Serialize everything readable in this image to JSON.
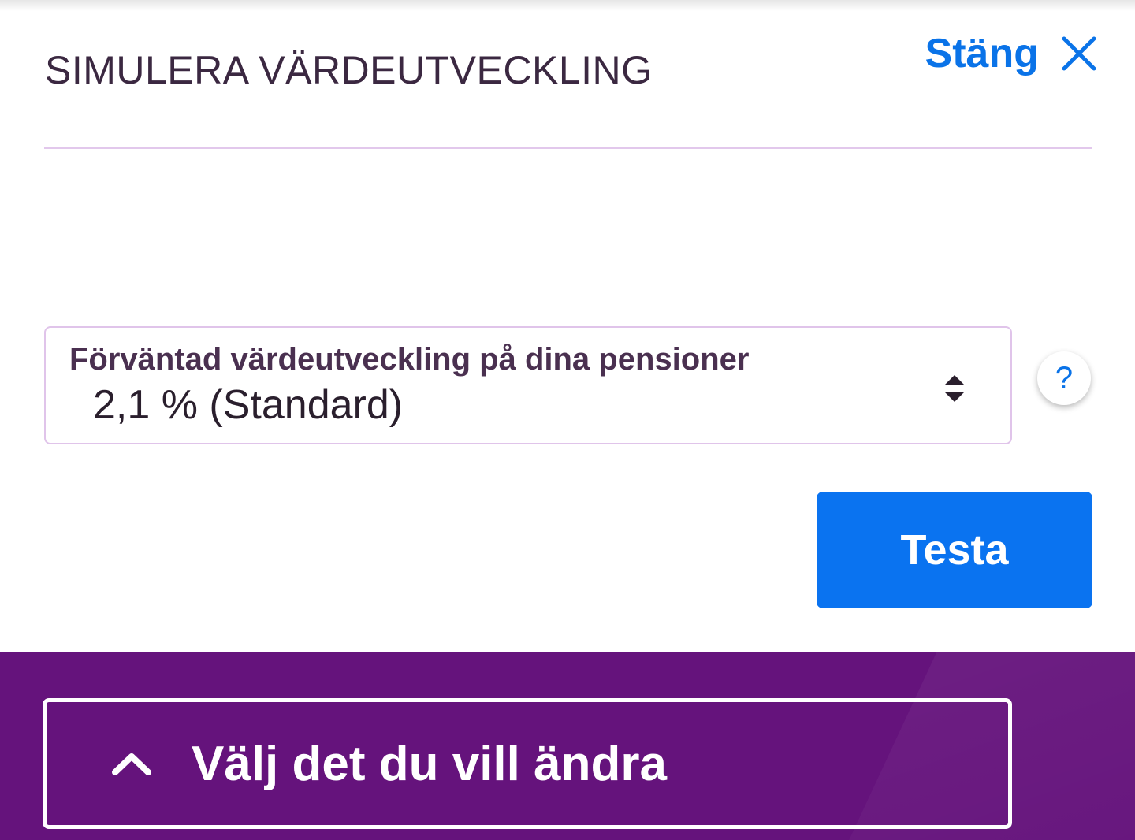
{
  "header": {
    "title": "SIMULERA VÄRDEUTVECKLING",
    "close_label": "Stäng"
  },
  "form": {
    "select_label": "Förväntad värdeutveckling på dina pensioner",
    "select_value": "2,1 % (Standard)",
    "help_label": "?",
    "submit_label": "Testa"
  },
  "footer": {
    "toggle_label": "Välj det du vill ändra"
  },
  "icons": {
    "close": "close-icon",
    "sort": "sort-arrows-icon",
    "chevron": "chevron-up-icon"
  },
  "colors": {
    "accent": "#0a73e8",
    "footer_bg": "#65137c",
    "title_text": "#3b2841",
    "border": "#e0c4ea"
  }
}
